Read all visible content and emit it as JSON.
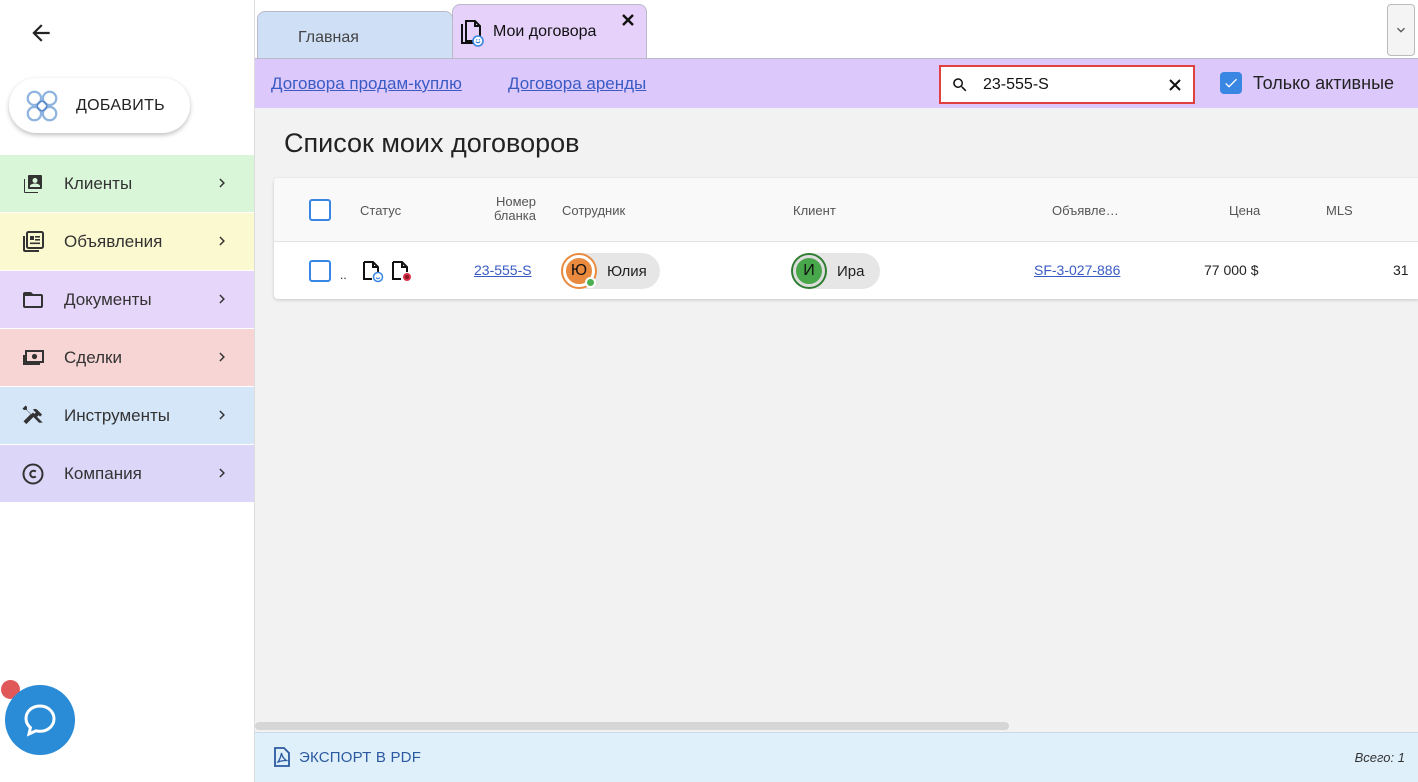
{
  "sidebar": {
    "add_label": "ДОБАВИТЬ",
    "items": [
      {
        "label": "Клиенты",
        "icon": "contact-card-icon",
        "color": "#d9f6d9"
      },
      {
        "label": "Объявления",
        "icon": "listing-icon",
        "color": "#fbf9cf"
      },
      {
        "label": "Документы",
        "icon": "folder-icon",
        "color": "#e6d6fa"
      },
      {
        "label": "Сделки",
        "icon": "money-icon",
        "color": "#f8d5d5"
      },
      {
        "label": "Инструменты",
        "icon": "tools-icon",
        "color": "#d6e6f9"
      },
      {
        "label": "Компания",
        "icon": "copyright-icon",
        "color": "#dcd6f9"
      }
    ]
  },
  "tabs": {
    "home": "Главная",
    "active": "Мои договора"
  },
  "subbar": {
    "link_sale": "Договора продам-куплю",
    "link_rent": "Договора аренды",
    "search_value": "23-555-S",
    "only_active_label": "Только активные",
    "only_active_checked": true
  },
  "page": {
    "title": "Список моих договоров"
  },
  "table": {
    "headers": {
      "status": "Статус",
      "form_number_line1": "Номер",
      "form_number_line2": "бланка",
      "employee": "Сотрудник",
      "client": "Клиент",
      "listing": "Объявле…",
      "price": "Цена",
      "mls": "MLS"
    },
    "rows": [
      {
        "status_more": "..",
        "form_number": "23-555-S",
        "employee_initial": "Ю",
        "employee_name": "Юлия",
        "client_initial": "И",
        "client_name": "Ира",
        "listing": "SF-3-027-886",
        "price": "77 000 $",
        "cut_value": "31"
      }
    ]
  },
  "footer": {
    "export_label": "ЭКСПОРТ В PDF",
    "total": "Всего: 1"
  },
  "colors": {
    "accent": "#3a86e3",
    "tab_active": "#e5d1fa",
    "subbar": "#dcc8fb",
    "search_highlight": "#e0403f",
    "chat": "#2a8bd6"
  }
}
